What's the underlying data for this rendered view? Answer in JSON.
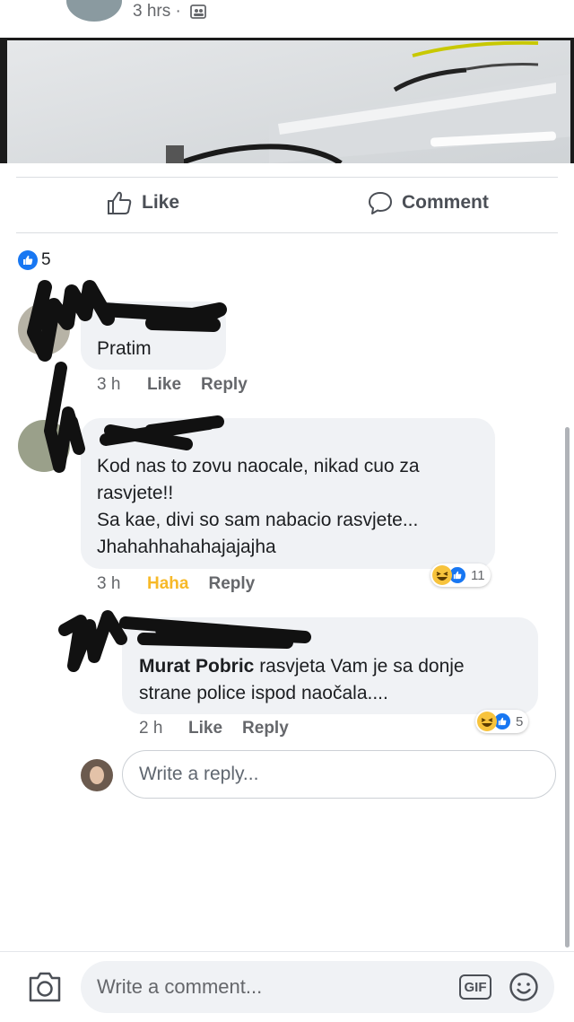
{
  "header": {
    "time": "3 hrs ·"
  },
  "actions": {
    "like": "Like",
    "comment": "Comment"
  },
  "reactions_summary": {
    "count": "5"
  },
  "comments": [
    {
      "text": "Pratim",
      "time": "3 h",
      "reaction_action": "Like",
      "reply": "Reply"
    },
    {
      "lines": [
        "Kod nas to zovu naocale, nikad cuo za",
        "rasvjete!!",
        "Sa kae, divi so sam nabacio rasvjete...",
        "Jhahahhahahajajajha"
      ],
      "time": "3 h",
      "reaction_action": "Haha",
      "reply": "Reply",
      "reaction_count": "11"
    },
    {
      "mention": "Murat Pobric",
      "line1_rest": " rasvjeta Vam je sa donje",
      "line2": "strane police ispod naočala....",
      "time": "2 h",
      "reaction_action": "Like",
      "reply": "Reply",
      "reaction_count": "5"
    }
  ],
  "reply_box": {
    "placeholder": "Write a reply..."
  },
  "comment_box": {
    "placeholder": "Write a comment...",
    "gif": "GIF"
  },
  "colors": {
    "accent": "#1877f2",
    "haha_active": "#f7b928"
  }
}
